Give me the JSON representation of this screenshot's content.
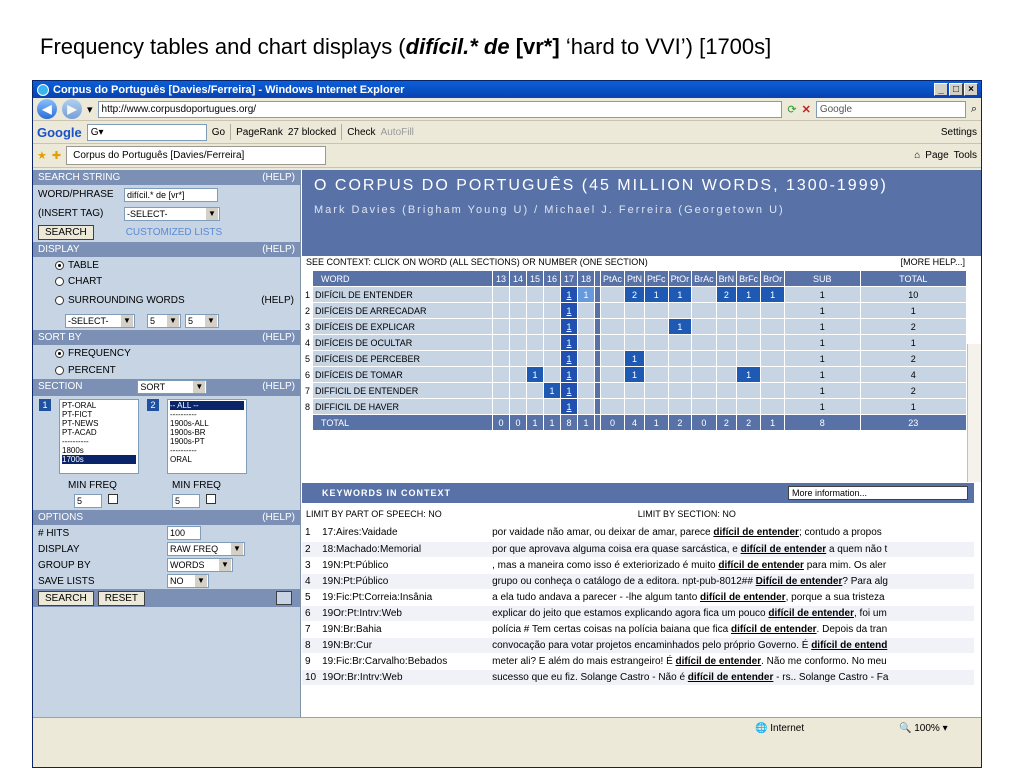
{
  "slide": {
    "title_pre": "Frequency tables and chart displays (",
    "title_bold_italic": "difícil.* de",
    "title_space": " ",
    "title_bold": "[vr*]",
    "title_post": " ‘hard to VVI’) [1700s]"
  },
  "window": {
    "title": "Corpus do Português [Davies/Ferreira] - Windows Internet Explorer",
    "url": "http://www.corpusdoportugues.org/",
    "search_placeholder": "Google",
    "tab_title": "Corpus do Português [Davies/Ferreira]",
    "toolbar": {
      "google": "Google",
      "go": "Go",
      "pagerank": "PageRank",
      "blocked": "27 blocked",
      "check": "Check",
      "autofill": "AutoFill",
      "settings": "Settings",
      "page": "Page",
      "tools": "Tools"
    },
    "status": {
      "zone": "Internet",
      "zoom": "100%"
    }
  },
  "left": {
    "search_string": "SEARCH STRING",
    "help": "(HELP)",
    "word_phrase_label": "WORD/PHRASE",
    "word_phrase_value": "difícil.* de [vr*]",
    "insert_tag_label": "(INSERT TAG)",
    "insert_tag_value": "-SELECT-",
    "search_btn": "SEARCH",
    "customized_lists": "CUSTOMIZED LISTS",
    "display": "DISPLAY",
    "table": "TABLE",
    "chart": "CHART",
    "surrounding_words": "SURROUNDING WORDS",
    "sur_select": "-SELECT-",
    "sur_left": "5",
    "sur_right": "5",
    "sort_by": "SORT BY",
    "frequency": "FREQUENCY",
    "percent": "PERCENT",
    "section": "SECTION",
    "sort": "SORT",
    "list1_num": "1",
    "list2_num": "2",
    "list1": [
      "PT-ORAL",
      "PT-FICT",
      "PT-NEWS",
      "PT-ACAD",
      "----------",
      "1800s",
      "1700s"
    ],
    "list1_selected": "1700s",
    "list2": [
      "-- ALL --",
      "----------",
      "1900s-ALL",
      "1900s-BR",
      "1900s-PT",
      "----------",
      "ORAL"
    ],
    "list2_selected": "-- ALL --",
    "min_freq": "MIN FREQ",
    "min_freq1": "5",
    "min_freq2": "5",
    "options": "OPTIONS",
    "hits_label": "# HITS",
    "hits_value": "100",
    "display_label": "DISPLAY",
    "display_value": "RAW FREQ",
    "group_label": "GROUP BY",
    "group_value": "WORDS",
    "save_label": "SAVE LISTS",
    "save_value": "NO",
    "search2": "SEARCH",
    "reset": "RESET"
  },
  "banner": {
    "title": "O CORPUS DO PORTUGUÊS (45 MILLION WORDS, 1300-1999)",
    "authors": "Mark Davies (Brigham Young U) / Michael J. Ferreira (Georgetown U)"
  },
  "ctx": {
    "left": "SEE CONTEXT: CLICK ON WORD (ALL SECTIONS) OR NUMBER (ONE SECTION)",
    "right": "[MORE HELP...]"
  },
  "freq": {
    "headers": [
      "WORD",
      "13",
      "14",
      "15",
      "16",
      "17",
      "18",
      "PtAc",
      "PtN",
      "PtFc",
      "PtOr",
      "BrAc",
      "BrN",
      "BrFc",
      "BrOr",
      "SUB",
      "TOTAL"
    ],
    "rows": [
      {
        "n": "1",
        "word": "DIFÍCIL DE ENTENDER",
        "c": [
          "",
          "",
          "",
          "",
          "1",
          "1",
          "",
          "2",
          "1",
          "1",
          "",
          "2",
          "1",
          "1"
        ],
        "sub": "1",
        "total": "10"
      },
      {
        "n": "2",
        "word": "DIFÍCEIS DE ARRECADAR",
        "c": [
          "",
          "",
          "",
          "",
          "1",
          "",
          "",
          "",
          "",
          "",
          "",
          "",
          "",
          ""
        ],
        "sub": "1",
        "total": "1"
      },
      {
        "n": "3",
        "word": "DIFÍCEIS DE EXPLICAR",
        "c": [
          "",
          "",
          "",
          "",
          "1",
          "",
          "",
          "",
          "",
          "1",
          "",
          "",
          "",
          ""
        ],
        "sub": "1",
        "total": "2"
      },
      {
        "n": "4",
        "word": "DIFÍCEIS DE OCULTAR",
        "c": [
          "",
          "",
          "",
          "",
          "1",
          "",
          "",
          "",
          "",
          "",
          "",
          "",
          "",
          ""
        ],
        "sub": "1",
        "total": "1"
      },
      {
        "n": "5",
        "word": "DIFÍCEIS DE PERCEBER",
        "c": [
          "",
          "",
          "",
          "",
          "1",
          "",
          "",
          "1",
          "",
          "",
          "",
          "",
          "",
          ""
        ],
        "sub": "1",
        "total": "2"
      },
      {
        "n": "6",
        "word": "DIFÍCEIS DE TOMAR",
        "c": [
          "",
          "",
          "1",
          "",
          "1",
          "",
          "",
          "1",
          "",
          "",
          "",
          "",
          "1",
          ""
        ],
        "sub": "1",
        "total": "4"
      },
      {
        "n": "7",
        "word": "DIFFICIL DE ENTENDER",
        "c": [
          "",
          "",
          "",
          "1",
          "1",
          "",
          "",
          "",
          "",
          "",
          "",
          "",
          "",
          ""
        ],
        "sub": "1",
        "total": "2"
      },
      {
        "n": "8",
        "word": "DIFFICIL DE HAVER",
        "c": [
          "",
          "",
          "",
          "",
          "1",
          "",
          "",
          "",
          "",
          "",
          "",
          "",
          "",
          ""
        ],
        "sub": "1",
        "total": "1"
      }
    ],
    "total_label": "TOTAL",
    "totals": [
      "0",
      "0",
      "1",
      "1",
      "8",
      "1",
      "0",
      "4",
      "1",
      "2",
      "0",
      "2",
      "2",
      "1"
    ],
    "total_sub": "8",
    "total_total": "23"
  },
  "kwic": {
    "header": "KEYWORDS IN CONTEXT",
    "more": "More information...",
    "filter_pos": "LIMIT BY PART OF SPEECH: NO",
    "filter_section": "LIMIT BY SECTION:  NO",
    "rows": [
      {
        "n": "1",
        "src": "17:Aires:Vaidade",
        "pre": "por vaidade não amar, ou deixar de amar, parece ",
        "kw": "difícil de entender",
        "post": "; contudo a propos"
      },
      {
        "n": "2",
        "src": "18:Machado:Memorial",
        "pre": "por que aprovava alguma coisa era quase sarcástica, e ",
        "kw": "difícil de entender",
        "post": " a quem não t"
      },
      {
        "n": "3",
        "src": "19N:Pt:Público",
        "pre": ", mas a maneira como isso é exteriorizado é muito ",
        "kw": "difícil de entender",
        "post": " para mim. Os aler"
      },
      {
        "n": "4",
        "src": "19N:Pt:Público",
        "pre": "grupo ou conheça o catálogo de a editora. npt-pub-8012## ",
        "kw": "Difícil de entender",
        "post": "? Para alg"
      },
      {
        "n": "5",
        "src": "19:Fic:Pt:Correia:Insânia",
        "pre": "a ela tudo andava a parecer - -lhe algum tanto ",
        "kw": "difícil de entender",
        "post": ", porque a sua tristeza"
      },
      {
        "n": "6",
        "src": "19Or:Pt:Intrv:Web",
        "pre": "explicar do jeito que estamos explicando agora fica um pouco ",
        "kw": "difícil de entender",
        "post": ", foi um"
      },
      {
        "n": "7",
        "src": "19N:Br:Bahia",
        "pre": "polícia # Tem certas coisas na polícia baiana que fica ",
        "kw": "difícil de entender",
        "post": ". Depois da tran"
      },
      {
        "n": "8",
        "src": "19N:Br:Cur",
        "pre": "convocação para votar projetos encaminhados pelo próprio Governo. É ",
        "kw": "difícil de entend",
        "post": ""
      },
      {
        "n": "9",
        "src": "19:Fic:Br:Carvalho:Bebados",
        "pre": "meter ali? E além do mais estrangeiro! É ",
        "kw": "difícil de entender",
        "post": ". Não me conformo. No meu"
      },
      {
        "n": "10",
        "src": "19Or:Br:Intrv:Web",
        "pre": "sucesso que eu fiz. Solange Castro - Não é ",
        "kw": "difícil de entender",
        "post": " - rs.. Solange Castro - Fa"
      }
    ]
  }
}
